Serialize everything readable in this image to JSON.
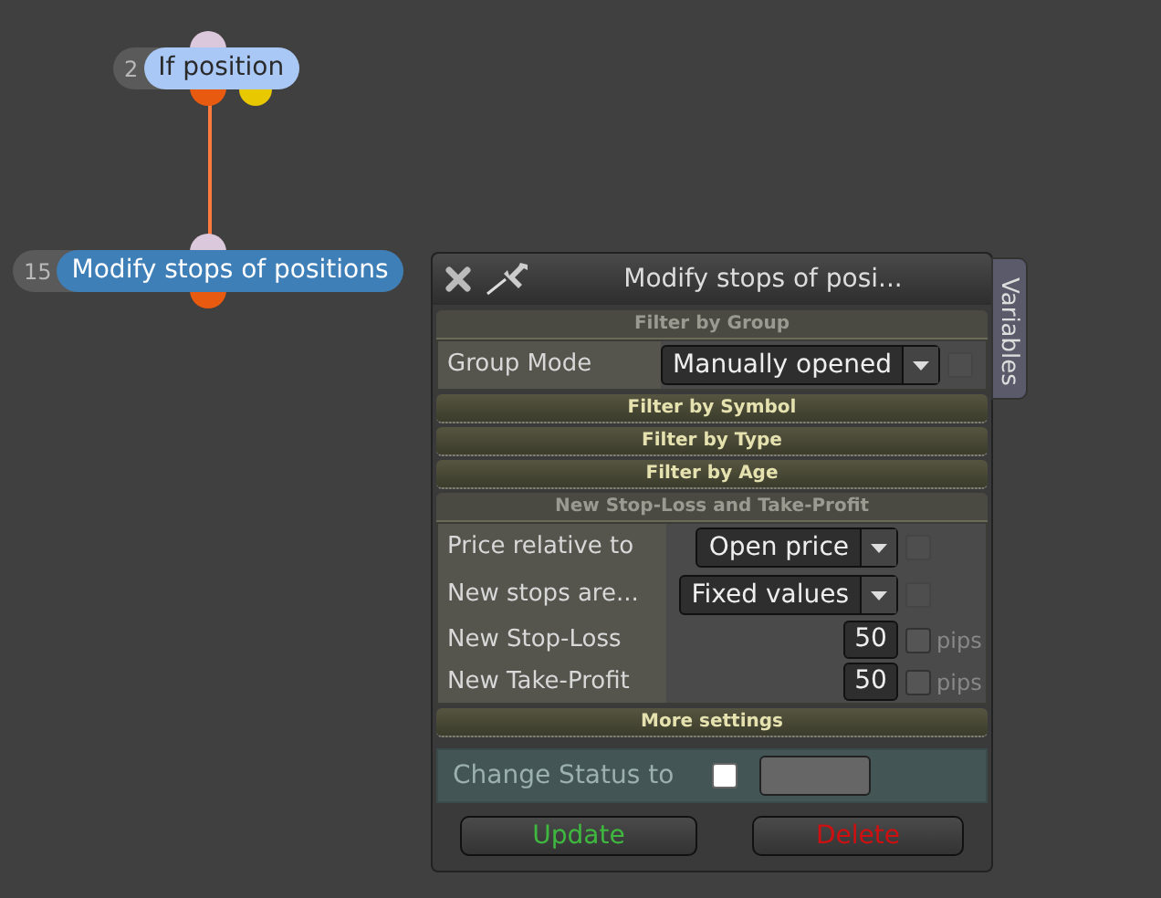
{
  "nodes": [
    {
      "number": "2",
      "label": "If position",
      "color": "#a9c8f5"
    },
    {
      "number": "15",
      "label": "Modify stops of positions",
      "color": "#3f7fb8"
    }
  ],
  "dialog": {
    "title": "Modify stops of posi...",
    "side_tab": "Variables",
    "sections": [
      {
        "title": "Filter by Group",
        "expanded": true,
        "rows": [
          {
            "kind": "dropdown",
            "label": "Group Mode",
            "value": "Manually opened",
            "checked": false
          }
        ]
      },
      {
        "title": "Filter by Symbol",
        "expanded": false
      },
      {
        "title": "Filter by Type",
        "expanded": false
      },
      {
        "title": "Filter by Age",
        "expanded": false
      },
      {
        "title": "New Stop-Loss and Take-Profit",
        "expanded": true,
        "rows": [
          {
            "kind": "dropdown",
            "label": "Price relative to",
            "value": "Open price",
            "checked": false
          },
          {
            "kind": "dropdown",
            "label": "New stops are...",
            "value": "Fixed values",
            "checked": false
          },
          {
            "kind": "number",
            "label": "New Stop-Loss",
            "value": "50",
            "unit": "pips",
            "checked": false
          },
          {
            "kind": "number",
            "label": "New Take-Profit",
            "value": "50",
            "unit": "pips",
            "checked": false
          }
        ]
      },
      {
        "title": "More settings",
        "expanded": false
      }
    ],
    "status": {
      "label": "Change Status to",
      "checked": false
    },
    "buttons": [
      {
        "label": "Update",
        "kind": "update"
      },
      {
        "label": "Delete",
        "kind": "delete"
      }
    ]
  }
}
